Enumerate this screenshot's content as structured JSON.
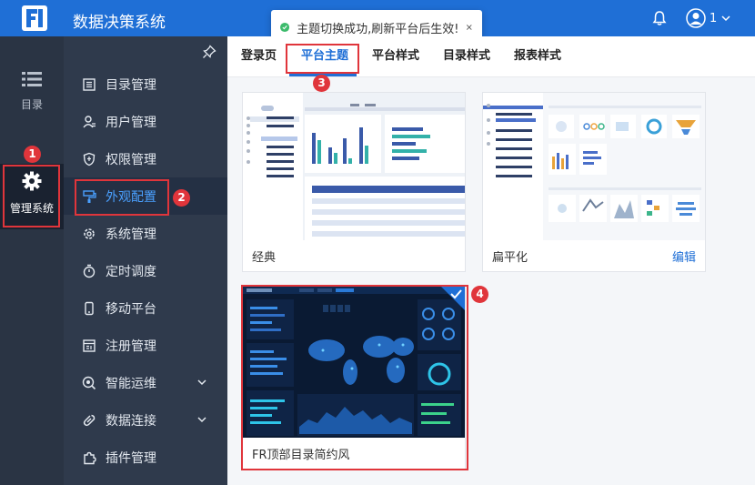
{
  "app": {
    "title": "数据决策系统",
    "user_name": "1"
  },
  "toast": {
    "message": "主题切换成功,刷新平台后生效!"
  },
  "rail": {
    "catalog_label": "目录",
    "admin_label": "管理系统"
  },
  "sidebar": {
    "items": [
      {
        "label": "目录管理",
        "icon": "catalog-icon"
      },
      {
        "label": "用户管理",
        "icon": "user-icon"
      },
      {
        "label": "权限管理",
        "icon": "shield-icon"
      },
      {
        "label": "外观配置",
        "icon": "paint-icon",
        "active": true
      },
      {
        "label": "系统管理",
        "icon": "gear-icon"
      },
      {
        "label": "定时调度",
        "icon": "stopwatch-icon"
      },
      {
        "label": "移动平台",
        "icon": "mobile-icon"
      },
      {
        "label": "注册管理",
        "icon": "register-icon"
      },
      {
        "label": "智能运维",
        "icon": "ops-icon",
        "expandable": true
      },
      {
        "label": "数据连接",
        "icon": "link-icon",
        "expandable": true
      },
      {
        "label": "插件管理",
        "icon": "plugin-icon"
      }
    ]
  },
  "tabs": [
    {
      "label": "登录页"
    },
    {
      "label": "平台主题",
      "active": true
    },
    {
      "label": "平台样式"
    },
    {
      "label": "目录样式"
    },
    {
      "label": "报表样式"
    }
  ],
  "themes": [
    {
      "name": "经典",
      "edit": ""
    },
    {
      "name": "扁平化",
      "edit": "编辑"
    },
    {
      "name": "FR顶部目录简约风",
      "selected": true
    }
  ],
  "annotations": [
    "1",
    "2",
    "3",
    "4"
  ],
  "colors": {
    "header": "#1f6fd6",
    "accent": "#1f6fd6",
    "annotation": "#e0353b",
    "rail": "#2a3444",
    "sidebar": "#2f3a4c"
  }
}
